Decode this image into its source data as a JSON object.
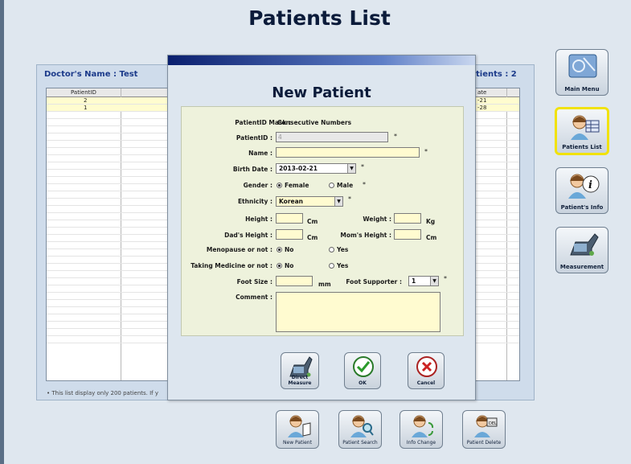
{
  "page": {
    "title": "Patients List"
  },
  "list": {
    "doctor_label": "Doctor's Name : Test",
    "patients_count": "tients : 2",
    "columns": {
      "patient_id": "PatientID",
      "date": "ate"
    },
    "rows": [
      {
        "id": "2",
        "date": "-21"
      },
      {
        "id": "1",
        "date": "-28"
      }
    ],
    "footnote": "• This list display only 200 patients. If y"
  },
  "sidebar": {
    "items": [
      {
        "label": "Main Menu"
      },
      {
        "label": "Patients List"
      },
      {
        "label": "Patient's Info"
      },
      {
        "label": "Measurement"
      }
    ]
  },
  "bottom_toolbar": {
    "new_patient": "New Patient",
    "patient_search": "Patient Search",
    "info_change": "Info Change",
    "patient_delete": "Patient Delete"
  },
  "dialog": {
    "title": "New Patient",
    "fields": {
      "mask_label": "PatientID Mask :",
      "mask_value": "Consecutive Numbers",
      "patient_id_label": "PatientID :",
      "patient_id_value": "4",
      "name_label": "Name :",
      "name_value": "",
      "birth_label": "Birth Date :",
      "birth_value": "2013-02-21",
      "gender_label": "Gender :",
      "gender_female": "Female",
      "gender_male": "Male",
      "ethnicity_label": "Ethnicity :",
      "ethnicity_value": "Korean",
      "height_label": "Height :",
      "height_unit": "Cm",
      "weight_label": "Weight :",
      "weight_unit": "Kg",
      "dad_label": "Dad's Height :",
      "dad_unit": "Cm",
      "mom_label": "Mom's Height :",
      "mom_unit": "Cm",
      "menopause_label": "Menopause or not :",
      "menopause_no": "No",
      "menopause_yes": "Yes",
      "medicine_label": "Taking Medicine or not :",
      "medicine_no": "No",
      "medicine_yes": "Yes",
      "foot_label": "Foot Size :",
      "foot_unit": "mm",
      "supporter_label": "Foot Supporter :",
      "supporter_value": "1",
      "comment_label": "Comment :",
      "required_mark": "*"
    },
    "buttons": {
      "direct_measure": "Direct Measure",
      "ok": "OK",
      "cancel": "Cancel"
    }
  }
}
